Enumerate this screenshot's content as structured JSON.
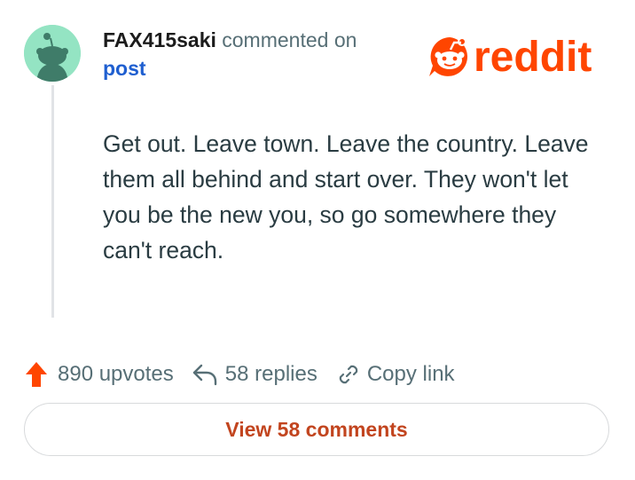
{
  "comment": {
    "username": "FAX415saki",
    "action_text": "commented on",
    "post_link_label": "post",
    "body": "Get out. Leave town. Leave the country. Leave them all behind and start over. They won't let you be the new you, so go somewhere they can't reach."
  },
  "brand": {
    "logo_text": "reddit",
    "color": "#ff4500"
  },
  "actions": {
    "upvotes_label": "890 upvotes",
    "replies_label": "58 replies",
    "copy_link_label": "Copy link"
  },
  "footer": {
    "view_comments_label": "View 58 comments"
  },
  "colors": {
    "avatar_bg": "#94e4c3",
    "upvote": "#ff4500",
    "link": "#1f5fd0",
    "comments_button_text": "#c2451f"
  },
  "icons": [
    "snoo-avatar-icon",
    "reddit-logo-icon",
    "upvote-arrow-icon",
    "reply-arrow-icon",
    "link-chain-icon"
  ]
}
